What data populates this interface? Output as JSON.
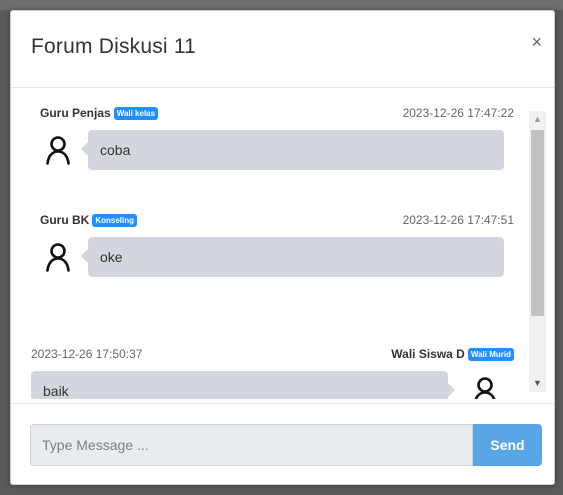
{
  "modal": {
    "title": "Forum Diskusi 11",
    "close_label": "×"
  },
  "messages": [
    {
      "author": "Guru Penjas",
      "role": "Wali kelas",
      "time": "2023-12-26 17:47:22",
      "text": "coba",
      "side": "left"
    },
    {
      "author": "Guru BK",
      "role": "Konseling",
      "time": "2023-12-26 17:47:51",
      "text": "oke",
      "side": "left"
    },
    {
      "author": "Wali Siswa D",
      "role": "Wali Murid",
      "time": "2023-12-26 17:50:37",
      "text": "baik",
      "side": "right"
    }
  ],
  "scrollbar": {
    "up_label": "▲",
    "down_label": "▼"
  },
  "composer": {
    "placeholder": "Type Message ...",
    "send_label": "Send"
  },
  "colors": {
    "badge": "#1e90ff",
    "bubble": "#d3d6dc",
    "send_button": "#5aa5e6"
  },
  "icons": {
    "avatar": "user-icon",
    "close": "close-icon"
  }
}
